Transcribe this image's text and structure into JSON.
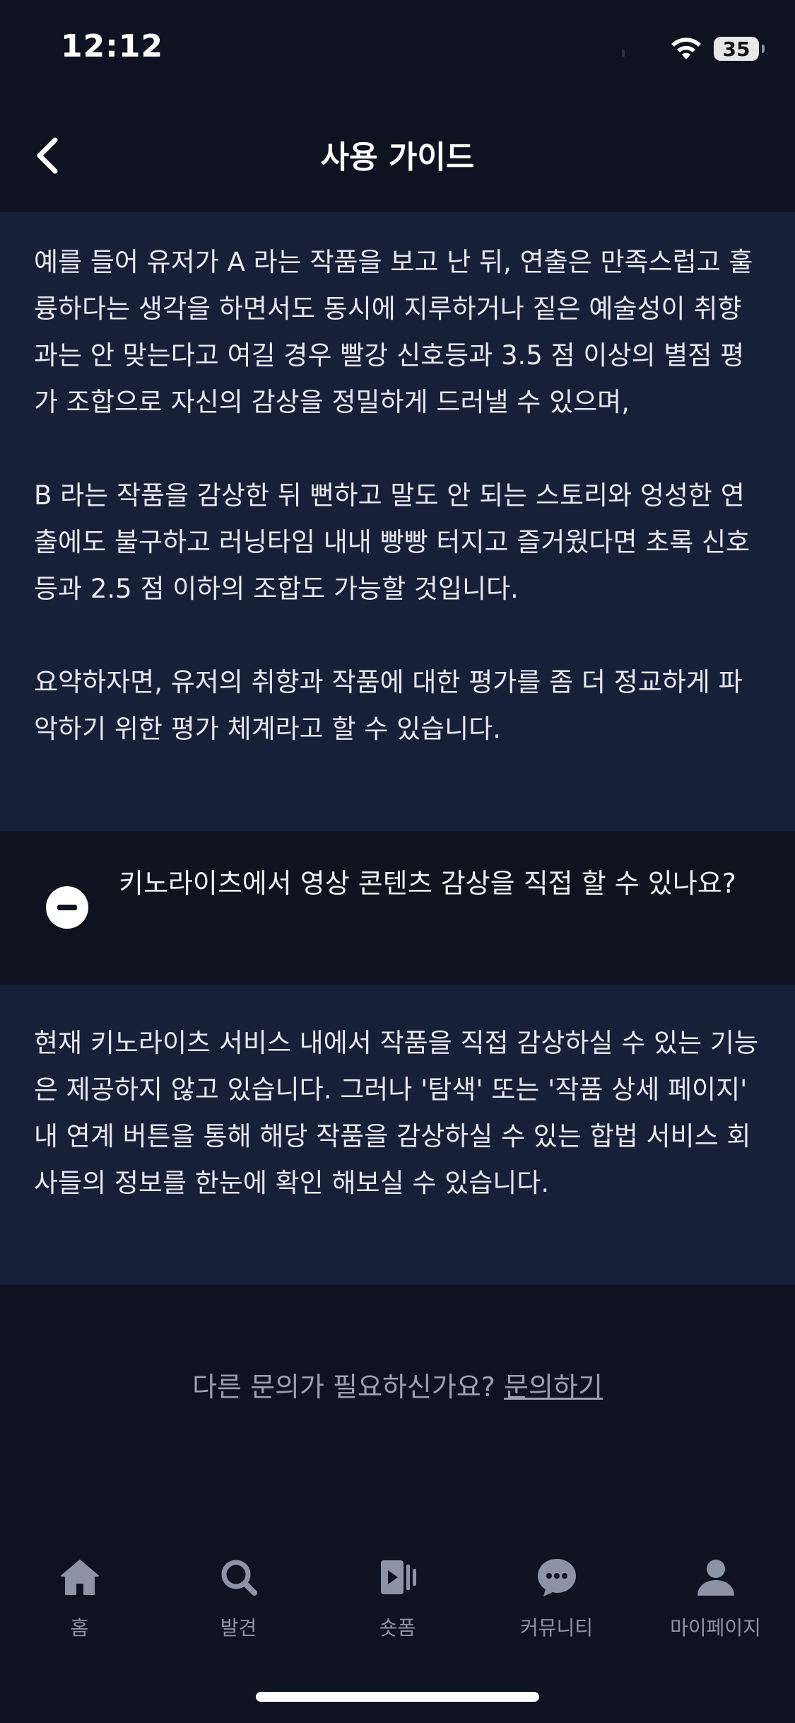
{
  "status_bar": {
    "time": "12:12",
    "battery": "35"
  },
  "header": {
    "title": "사용 가이드"
  },
  "faq": {
    "answer_1": [
      "예를 들어 유저가 A 라는 작품을 보고 난 뒤, 연출은 만족스럽고 훌륭하다는 생각을 하면서도 동시에 지루하거나 짙은 예술성이 취향과는 안 맞는다고 여길 경우 빨강 신호등과 3.5 점 이상의 별점 평가 조합으로 자신의 감상을 정밀하게 드러낼 수 있으며,",
      "B 라는 작품을 감상한 뒤 뻔하고 말도 안 되는 스토리와 엉성한 연출에도 불구하고 러닝타임 내내 빵빵 터지고 즐거웠다면 초록 신호등과 2.5 점 이하의 조합도 가능할 것입니다.",
      "요약하자면, 유저의 취향과 작품에 대한 평가를 좀 더 정교하게 파악하기 위한 평가 체계라고 할 수 있습니다."
    ],
    "question_2": "키노라이츠에서 영상 콘텐츠 감상을 직접 할 수 있나요?",
    "answer_2": "현재 키노라이츠 서비스 내에서 작품을 직접 감상하실 수 있는 기능은 제공하지 않고 있습니다. 그러나 '탐색' 또는 '작품 상세 페이지' 내 연계 버튼을 통해 해당 작품을 감상하실 수 있는 합법 서비스 회사들의 정보를 한눈에 확인 해보실 수 있습니다."
  },
  "inquiry": {
    "prompt": "다른 문의가 필요하신가요?",
    "link": "문의하기"
  },
  "tab_bar": {
    "items": [
      {
        "label": "홈",
        "icon": "home-icon"
      },
      {
        "label": "발견",
        "icon": "search-icon"
      },
      {
        "label": "숏폼",
        "icon": "shortform-icon"
      },
      {
        "label": "커뮤니티",
        "icon": "chat-bubble-icon"
      },
      {
        "label": "마이페이지",
        "icon": "person-icon"
      }
    ]
  },
  "colors": {
    "background": "#0f1321",
    "panel": "#172039",
    "tab_inactive": "#8c93a5"
  }
}
